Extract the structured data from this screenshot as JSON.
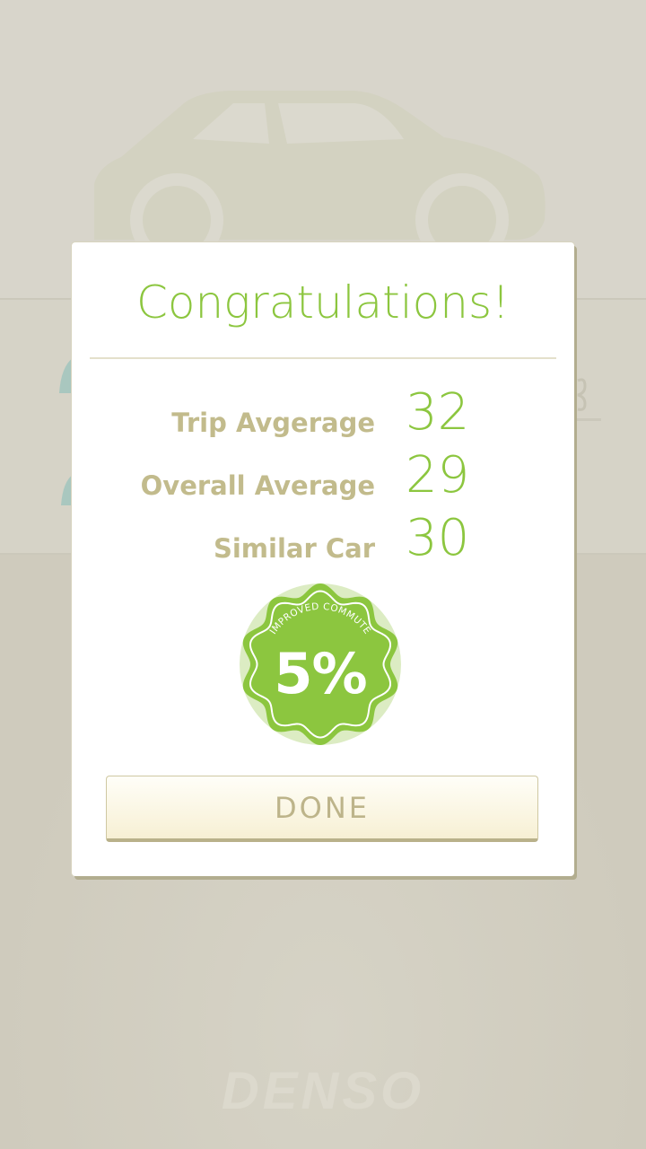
{
  "dialog": {
    "title": "Congratulations!",
    "stats": [
      {
        "label": "Trip Avgerage",
        "value": "32"
      },
      {
        "label": "Overall Average",
        "value": "29"
      },
      {
        "label": "Similar Car",
        "value": "30"
      }
    ],
    "badge": {
      "caption": "IMPROVED COMMUTE",
      "value": "5%",
      "icon": "seal-badge-icon"
    },
    "done_label": "DONE"
  },
  "background": {
    "brand": "DENSO",
    "car_icon": "car-icon"
  },
  "colors": {
    "accent_green": "#8cc63f",
    "label_khaki": "#c2bb8c",
    "button_text": "#bdb48a",
    "background": "#d2cfc2"
  }
}
